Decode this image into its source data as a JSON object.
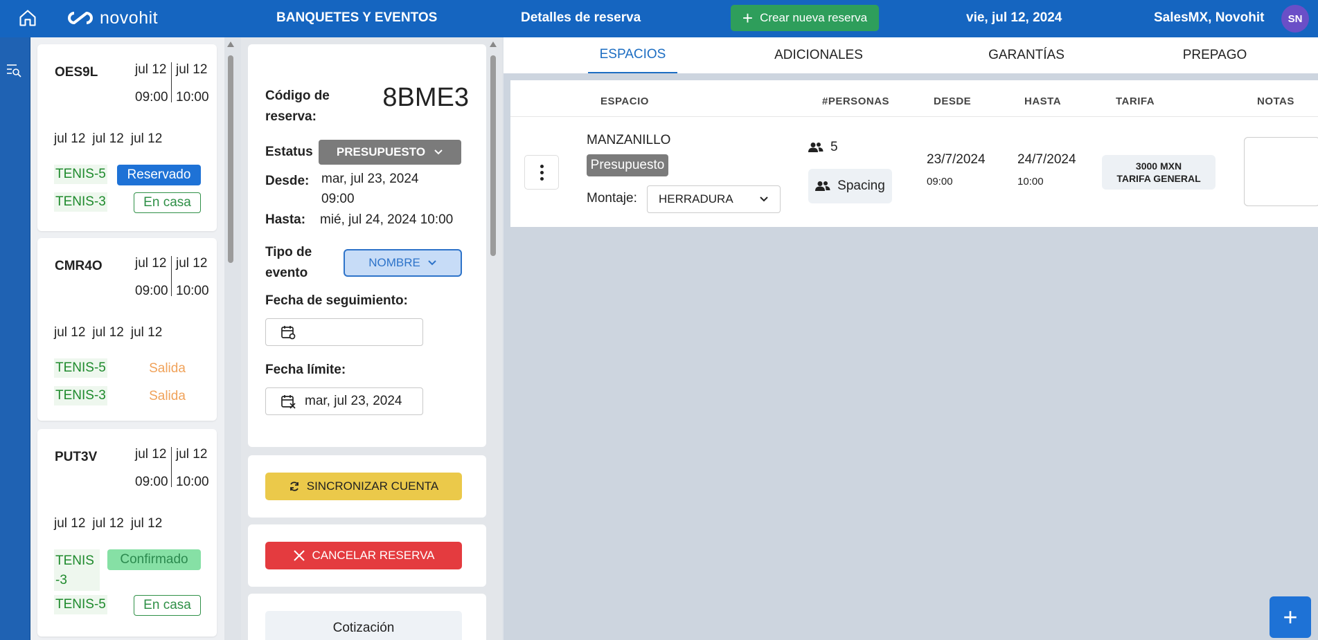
{
  "header": {
    "logo_text": "novohit",
    "module": "BANQUETES Y EVENTOS",
    "page": "Detalles de reserva",
    "create_label": "Crear nueva reserva",
    "date": "vie, jul 12, 2024",
    "user": "SalesMX, Novohit",
    "avatar_initials": "SN"
  },
  "cards": [
    {
      "code": "OES9L",
      "date_from": "jul 12",
      "date_to": "jul 12",
      "time_from": "09:00",
      "time_to": "10:00",
      "triple": [
        "jul 12",
        "jul 12",
        "jul 12"
      ],
      "rows": [
        {
          "court": "TENIS-5",
          "status": "Reservado",
          "style": "reservado"
        },
        {
          "court": "TENIS-3",
          "status": "En casa",
          "style": "encasa"
        }
      ]
    },
    {
      "code": "CMR4O",
      "date_from": "jul 12",
      "date_to": "jul 12",
      "time_from": "09:00",
      "time_to": "10:00",
      "triple": [
        "jul 12",
        "jul 12",
        "jul 12"
      ],
      "rows": [
        {
          "court": "TENIS-5",
          "status": "Salida",
          "style": "salida"
        },
        {
          "court": "TENIS-3",
          "status": "Salida",
          "style": "salida"
        }
      ]
    },
    {
      "code": "PUT3V",
      "date_from": "jul 12",
      "date_to": "jul 12",
      "time_from": "09:00",
      "time_to": "10:00",
      "triple": [
        "jul 12",
        "jul 12",
        "jul 12"
      ],
      "rows": [
        {
          "court": "TENIS-3",
          "status": "Confirmado",
          "style": "confirmado"
        },
        {
          "court": "TENIS-5",
          "status": "En casa",
          "style": "encasa"
        }
      ]
    }
  ],
  "detail": {
    "code_label": "Código de reserva:",
    "code": "8BME3",
    "status_label": "Estatus",
    "status_value": "PRESUPUESTO",
    "from_label": "Desde:",
    "from_value": "mar, jul 23, 2024 09:00",
    "to_label": "Hasta:",
    "to_value": "mié, jul 24, 2024 10:00",
    "type_label": "Tipo de evento",
    "type_value": "NOMBRE",
    "followup_label": "Fecha de seguimiento:",
    "followup_value": "",
    "deadline_label": "Fecha límite:",
    "deadline_value": "mar, jul 23, 2024",
    "sync_label": "SINCRONIZAR CUENTA",
    "cancel_label": "CANCELAR RESERVA",
    "quote_label": "Cotización"
  },
  "tabs": [
    "ESPACIOS",
    "ADICIONALES",
    "GARANTÍAS",
    "PREPAGO"
  ],
  "table": {
    "headers": [
      "ESPACIO",
      "#PERSONAS",
      "DESDE",
      "HASTA",
      "TARIFA",
      "NOTAS"
    ],
    "row": {
      "space": "MANZANILLO",
      "space_status": "Presupuesto",
      "montaje_label": "Montaje:",
      "montaje_value": "HERRADURA",
      "persons": "5",
      "spacing": "Spacing",
      "from_date": "23/7/2024",
      "from_time": "09:00",
      "to_date": "24/7/2024",
      "to_time": "10:00",
      "rate_amount": "3000 MXN",
      "rate_name": "TARIFA GENERAL"
    }
  },
  "colors": {
    "primary": "#1565c0",
    "create_green": "#2e9e5b",
    "sync_yellow": "#ebc94a",
    "cancel_red": "#e43b3f"
  }
}
